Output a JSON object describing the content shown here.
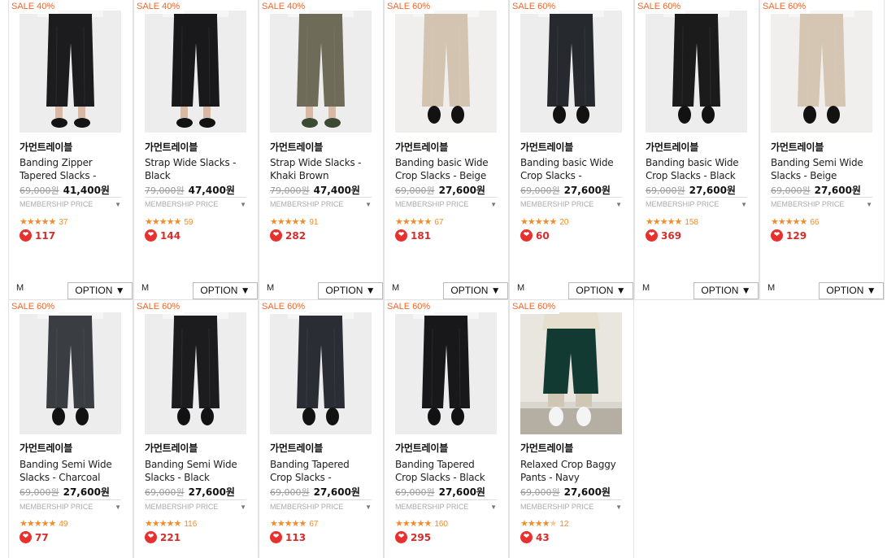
{
  "products": [
    {
      "badge": "SALE 40%",
      "brand": "가먼트레이블",
      "name": "Banding Zipper Tapered Slacks -",
      "orig": "69,000원",
      "price": "41,400원",
      "member": "MEMBERSHIP PRICE",
      "stars": 5,
      "reviews": "37",
      "likes": "117",
      "size": "M",
      "option": "OPTION ▼",
      "pants": "#1c1c1e",
      "shoes": "#141414",
      "bg": "#ededed",
      "skin": true
    },
    {
      "badge": "SALE 40%",
      "brand": "가먼트레이블",
      "name": "Strap Wide Slacks - Black",
      "orig": "79,000원",
      "price": "47,400원",
      "member": "MEMBERSHIP PRICE",
      "stars": 5,
      "reviews": "59",
      "likes": "144",
      "size": "M",
      "option": "OPTION ▼",
      "pants": "#19191b",
      "shoes": "#121212",
      "bg": "#ededed",
      "skin": true
    },
    {
      "badge": "SALE 40%",
      "brand": "가먼트레이블",
      "name": "Strap Wide Slacks - Khaki Brown",
      "orig": "79,000원",
      "price": "47,400원",
      "member": "MEMBERSHIP PRICE",
      "stars": 5,
      "reviews": "91",
      "likes": "282",
      "size": "M",
      "option": "OPTION ▼",
      "pants": "#6e6b58",
      "shoes": "#3c4a33",
      "bg": "#ededed",
      "skin": true
    },
    {
      "badge": "SALE 60%",
      "brand": "가먼트레이블",
      "name": "Banding basic Wide Crop Slacks - Beige",
      "orig": "69,000원",
      "price": "27,600원",
      "member": "MEMBERSHIP PRICE",
      "stars": 5,
      "reviews": "67",
      "likes": "181",
      "size": "M",
      "option": "OPTION ▼",
      "pants": "#d2c4b1",
      "shoes": "#121212",
      "bg": "#f0efed",
      "skin": false
    },
    {
      "badge": "SALE 60%",
      "brand": "가먼트레이블",
      "name": "Banding basic Wide Crop Slacks -",
      "orig": "69,000원",
      "price": "27,600원",
      "member": "MEMBERSHIP PRICE",
      "stars": 5,
      "reviews": "20",
      "likes": "60",
      "size": "M",
      "option": "OPTION ▼",
      "pants": "#26292e",
      "shoes": "#121212",
      "bg": "#ededed",
      "skin": false
    },
    {
      "badge": "SALE 60%",
      "brand": "가먼트레이블",
      "name": "Banding basic Wide Crop Slacks - Black",
      "orig": "69,000원",
      "price": "27,600원",
      "member": "MEMBERSHIP PRICE",
      "stars": 5,
      "reviews": "158",
      "likes": "369",
      "size": "M",
      "option": "OPTION ▼",
      "pants": "#1b1b1c",
      "shoes": "#121212",
      "bg": "#ededed",
      "skin": false
    },
    {
      "badge": "SALE 60%",
      "brand": "가먼트레이블",
      "name": "Banding Semi Wide Slacks - Beige",
      "orig": "69,000원",
      "price": "27,600원",
      "member": "MEMBERSHIP PRICE",
      "stars": 5,
      "reviews": "66",
      "likes": "129",
      "size": "M",
      "option": "OPTION ▼",
      "pants": "#d4c6b3",
      "shoes": "#121212",
      "bg": "#f0efed",
      "skin": false
    },
    {
      "badge": "SALE 60%",
      "brand": "가먼트레이블",
      "name": "Banding Semi Wide Slacks - Charcoal",
      "orig": "69,000원",
      "price": "27,600원",
      "member": "MEMBERSHIP PRICE",
      "stars": 5,
      "reviews": "49",
      "likes": "77",
      "pants": "#3a3d42",
      "shoes": "#121212",
      "bg": "#ededed",
      "skin": false
    },
    {
      "badge": "SALE 60%",
      "brand": "가먼트레이블",
      "name": "Banding Semi Wide Slacks - Black",
      "orig": "69,000원",
      "price": "27,600원",
      "member": "MEMBERSHIP PRICE",
      "stars": 5,
      "reviews": "116",
      "likes": "221",
      "pants": "#1c1c1e",
      "shoes": "#121212",
      "bg": "#ededed",
      "skin": false
    },
    {
      "badge": "SALE 60%",
      "brand": "가먼트레이블",
      "name": "Banding Tapered Crop Slacks -",
      "orig": "69,000원",
      "price": "27,600원",
      "member": "MEMBERSHIP PRICE",
      "stars": 5,
      "reviews": "67",
      "likes": "113",
      "pants": "#2a2d33",
      "shoes": "#121212",
      "bg": "#ededed",
      "skin": false
    },
    {
      "badge": "SALE 60%",
      "brand": "가먼트레이블",
      "name": "Banding Tapered Crop Slacks - Black",
      "orig": "69,000원",
      "price": "27,600원",
      "member": "MEMBERSHIP PRICE",
      "stars": 5,
      "reviews": "160",
      "likes": "295",
      "pants": "#18181a",
      "shoes": "#121212",
      "bg": "#ededed",
      "skin": false
    },
    {
      "badge": "SALE 60%",
      "brand": "가먼트레이블",
      "name": "Relaxed Crop Baggy Pants - Navy",
      "orig": "69,000원",
      "price": "27,600원",
      "member": "MEMBERSHIP PRICE",
      "stars": 4.5,
      "reviews": "12",
      "likes": "43",
      "pants": "#123a33",
      "shoes": "#f4f4f4",
      "bg": "#d9d6cf",
      "skin": false
    }
  ],
  "colors": {
    "sale": "#f0662d",
    "star": "#f28b2a",
    "heart": "#e8302e"
  }
}
